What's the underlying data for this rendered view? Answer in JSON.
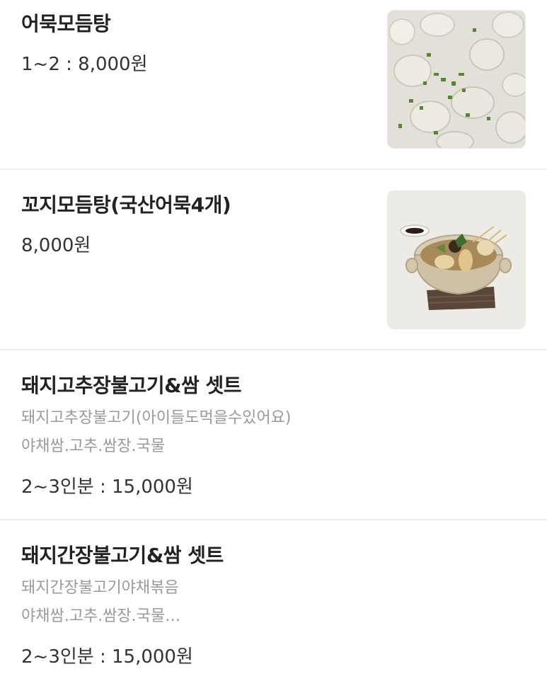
{
  "menu": {
    "items": [
      {
        "name": "어묵모듬탕",
        "price": "1~2 : 8,000원"
      },
      {
        "name": "꼬지모듬탕(국산어묵4개)",
        "price": "8,000원"
      },
      {
        "name": "돼지고추장불고기&쌈 셋트",
        "desc_line1": "돼지고추장불고기(아이들도먹을수있어요)",
        "desc_line2": "야채쌈.고추.쌈장.국물",
        "price": "2~3인분 : 15,000원"
      },
      {
        "name": "돼지간장불고기&쌈 셋트",
        "desc_line1": "돼지간장불고기야채볶음",
        "desc_line2": "야채쌈.고추.쌈장.국물…",
        "price": "2~3인분 : 15,000원"
      }
    ]
  }
}
